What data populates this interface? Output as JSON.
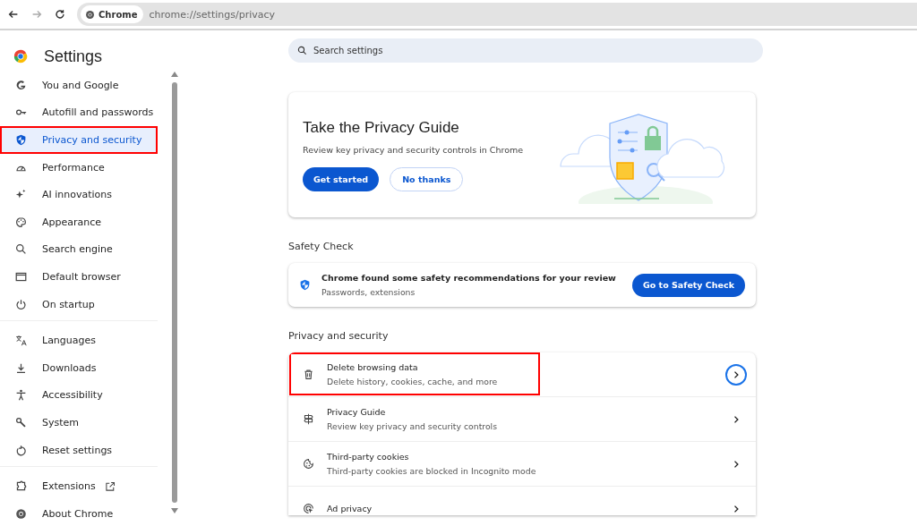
{
  "toolbar": {
    "chip": "Chrome",
    "url_host": "chrome://settings",
    "url_path": "/privacy"
  },
  "header": {
    "title": "Settings"
  },
  "search": {
    "placeholder": "Search settings"
  },
  "sidebar": {
    "groups": [
      [
        {
          "label": "You and Google",
          "selected": false,
          "highlighted": false
        },
        {
          "label": "Autofill and passwords",
          "selected": false,
          "highlighted": false
        },
        {
          "label": "Privacy and security",
          "selected": true,
          "highlighted": true
        },
        {
          "label": "Performance",
          "selected": false,
          "highlighted": false
        },
        {
          "label": "AI innovations",
          "selected": false,
          "highlighted": false
        },
        {
          "label": "Appearance",
          "selected": false,
          "highlighted": false
        },
        {
          "label": "Search engine",
          "selected": false,
          "highlighted": false
        },
        {
          "label": "Default browser",
          "selected": false,
          "highlighted": false
        },
        {
          "label": "On startup",
          "selected": false,
          "highlighted": false
        }
      ],
      [
        {
          "label": "Languages",
          "selected": false,
          "highlighted": false
        },
        {
          "label": "Downloads",
          "selected": false,
          "highlighted": false
        },
        {
          "label": "Accessibility",
          "selected": false,
          "highlighted": false
        },
        {
          "label": "System",
          "selected": false,
          "highlighted": false
        },
        {
          "label": "Reset settings",
          "selected": false,
          "highlighted": false
        }
      ],
      [
        {
          "label": "Extensions",
          "selected": false,
          "highlighted": false,
          "external": true
        },
        {
          "label": "About Chrome",
          "selected": false,
          "highlighted": false
        }
      ]
    ]
  },
  "guide_card": {
    "title": "Take the Privacy Guide",
    "text": "Review key privacy and security controls in Chrome",
    "primary": "Get started",
    "secondary": "No thanks"
  },
  "safety": {
    "heading": "Safety Check",
    "title": "Chrome found some safety recommendations for your review",
    "subtitle": "Passwords, extensions",
    "button": "Go to Safety Check"
  },
  "privacy": {
    "heading": "Privacy and security",
    "rows": [
      {
        "title": "Delete browsing data",
        "subtitle": "Delete history, cookies, cache, and more",
        "highlighted": true,
        "focused": true
      },
      {
        "title": "Privacy Guide",
        "subtitle": "Review key privacy and security controls",
        "highlighted": false,
        "focused": false
      },
      {
        "title": "Third-party cookies",
        "subtitle": "Third-party cookies are blocked in Incognito mode",
        "highlighted": false,
        "focused": false
      },
      {
        "title": "Ad privacy",
        "highlighted": false,
        "focused": false
      }
    ]
  }
}
